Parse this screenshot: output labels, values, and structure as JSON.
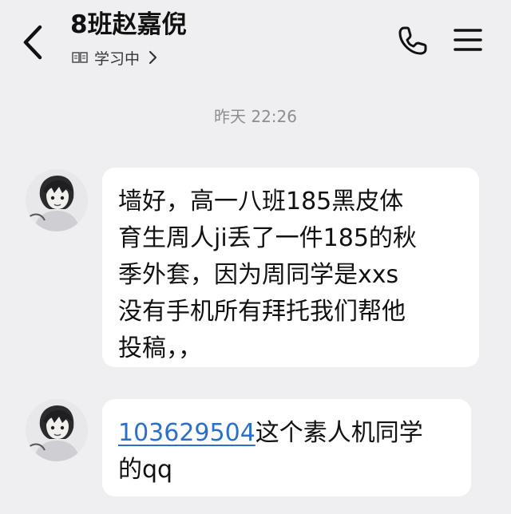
{
  "header": {
    "title": "8班赵嘉倪",
    "status": "学习中",
    "back_icon": "chevron-left-icon",
    "status_icon": "book-icon",
    "status_chevron": "chevron-right-icon",
    "call_icon": "phone-icon",
    "menu_icon": "hamburger-menu-icon"
  },
  "chat": {
    "timestamp": "昨天 22:26",
    "messages": [
      {
        "lines": [
          "墙好，高一八班185黑皮体",
          "育生周人ji丢了一件185的秋",
          "季外套，因为周同学是xxs",
          "没有手机所有拜托我们帮他",
          "投稿，，"
        ]
      },
      {
        "link": "103629504",
        "line1_rest": "这个素人机同学",
        "line2": "的qq"
      }
    ]
  },
  "colors": {
    "background": "#efeff2",
    "bubble": "#ffffff",
    "link": "#2a6fc9",
    "timestamp": "#8d8d93"
  }
}
